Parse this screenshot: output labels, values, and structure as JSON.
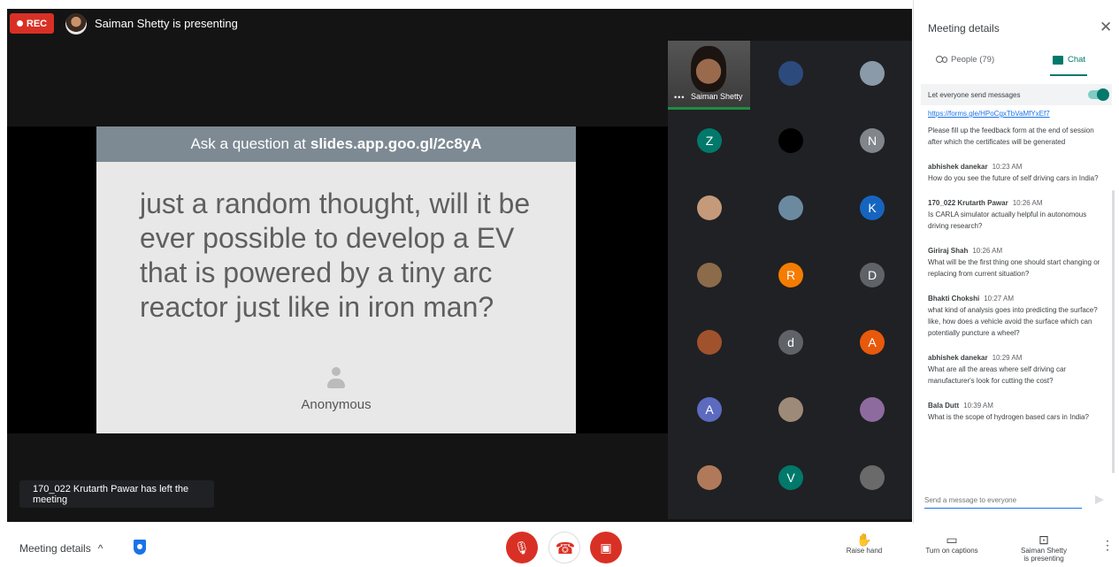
{
  "top": {
    "rec_label": "REC",
    "presenting": "Saiman Shetty is presenting"
  },
  "slide": {
    "header_prefix": "Ask a question at",
    "header_url": "slides.app.goo.gl/2c8yA",
    "question": "just a random thought, will it be ever possible to develop a EV that is powered by a tiny arc reactor just like in iron man?",
    "author": "Anonymous"
  },
  "toast": "170_022 Krutarth Pawar has left the meeting",
  "self_tile": {
    "name": "Saiman Shetty",
    "dots": "•••"
  },
  "participants": [
    {
      "initial": "",
      "color": "#2c4a7c"
    },
    {
      "initial": "",
      "color": "#8a9aa8"
    },
    {
      "initial": "Z",
      "color": "#00796b"
    },
    {
      "initial": "",
      "color": "#000000"
    },
    {
      "initial": "N",
      "color": "#80868b"
    },
    {
      "initial": "",
      "color": "#c49a7a"
    },
    {
      "initial": "",
      "color": "#6b8aa0"
    },
    {
      "initial": "K",
      "color": "#1565c0"
    },
    {
      "initial": "",
      "color": "#8b6b4a"
    },
    {
      "initial": "R",
      "color": "#f57c00"
    },
    {
      "initial": "D",
      "color": "#5f6368"
    },
    {
      "initial": "",
      "color": "#a0522d"
    },
    {
      "initial": "d",
      "color": "#5f6368"
    },
    {
      "initial": "A",
      "color": "#e8590c"
    },
    {
      "initial": "A",
      "color": "#5c6bc0"
    },
    {
      "initial": "",
      "color": "#9e8a78"
    },
    {
      "initial": "",
      "color": "#8e6b9e"
    },
    {
      "initial": "",
      "color": "#b07a5a"
    },
    {
      "initial": "V",
      "color": "#00796b"
    },
    {
      "initial": "",
      "color": "#6a6a6a"
    }
  ],
  "sidebar": {
    "title": "Meeting details",
    "close": "✕",
    "people_tab": "People (79)",
    "chat_tab": "Chat",
    "toggle_label": "Let everyone send messages",
    "link": "https://forms.gle/HPoCgxTbVaMfYxEf7",
    "system_message": "Please fill up the feedback form at the end of session after which the certificates will be generated",
    "messages": [
      {
        "sender": "abhishek danekar",
        "time": "10:23 AM",
        "text": "How do you see the future of self driving cars in India?"
      },
      {
        "sender": "170_022 Krutarth Pawar",
        "time": "10:26 AM",
        "text": "Is CARLA simulator actually helpful in autonomous driving research?"
      },
      {
        "sender": "Giriraj Shah",
        "time": "10:26 AM",
        "text": "What will be the first thing one should start changing or replacing from current situation?"
      },
      {
        "sender": "Bhakti Chokshi",
        "time": "10:27 AM",
        "text": "what kind of analysis goes into predicting the surface? like, how does a  vehicle avoid the surface which can potentially puncture a wheel?"
      },
      {
        "sender": "abhishek danekar",
        "time": "10:29 AM",
        "text": "What are all the areas where self driving car manufacturer's look for cutting the cost?"
      },
      {
        "sender": "Bala Dutt",
        "time": "10:39 AM",
        "text": "What is the scope of hydrogen based cars in India?"
      }
    ],
    "input_placeholder": "Send a message to everyone"
  },
  "bottom": {
    "meeting_details": "Meeting details",
    "chevron": "^",
    "raise_hand": "Raise hand",
    "captions": "Turn on captions",
    "presenting_line1": "Saiman Shetty",
    "presenting_line2": "is presenting",
    "more": "⋮"
  }
}
